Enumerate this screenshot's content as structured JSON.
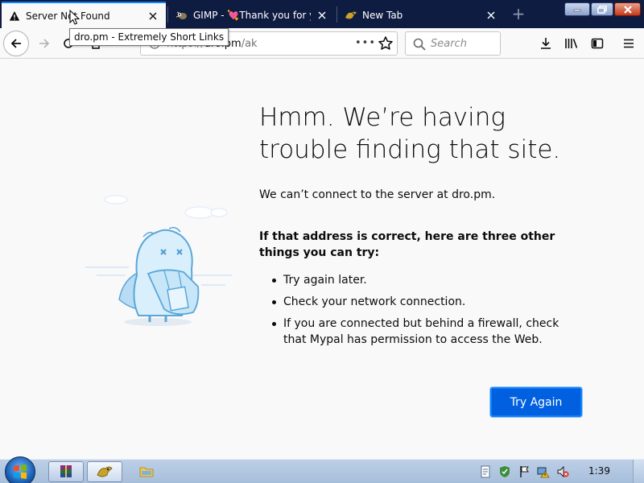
{
  "tabs": [
    {
      "title": "Server Not Found",
      "icon": "warning-icon",
      "active": true
    },
    {
      "title": "GIMP - 💘Thank you for yo",
      "icon": "gimp-icon",
      "active": false
    },
    {
      "title": "New Tab",
      "icon": "mypal-icon",
      "active": false
    }
  ],
  "new_tab_symbol": "+",
  "tooltip": "dro.pm - Extremely Short Links",
  "url": {
    "prefix": "https://",
    "host": "dro.pm",
    "path": "/ak"
  },
  "search": {
    "placeholder": "Search"
  },
  "page_action_symbol": "•••",
  "error": {
    "title": "Hmm. We’re having trouble finding that site.",
    "description": "We can’t connect to the server at dro.pm.",
    "suggest_heading": "If that address is correct, here are three other things you can try:",
    "suggestions": [
      "Try again later.",
      "Check your network connection.",
      "If you are connected but behind a firewall, check that Mypal has permission to access the Web."
    ],
    "button": "Try Again"
  },
  "taskbar": {
    "clock": "1:39"
  },
  "colors": {
    "tab_strip": "#0f1c42",
    "accent": "#0060df",
    "page_bg": "#f9f9fa"
  }
}
